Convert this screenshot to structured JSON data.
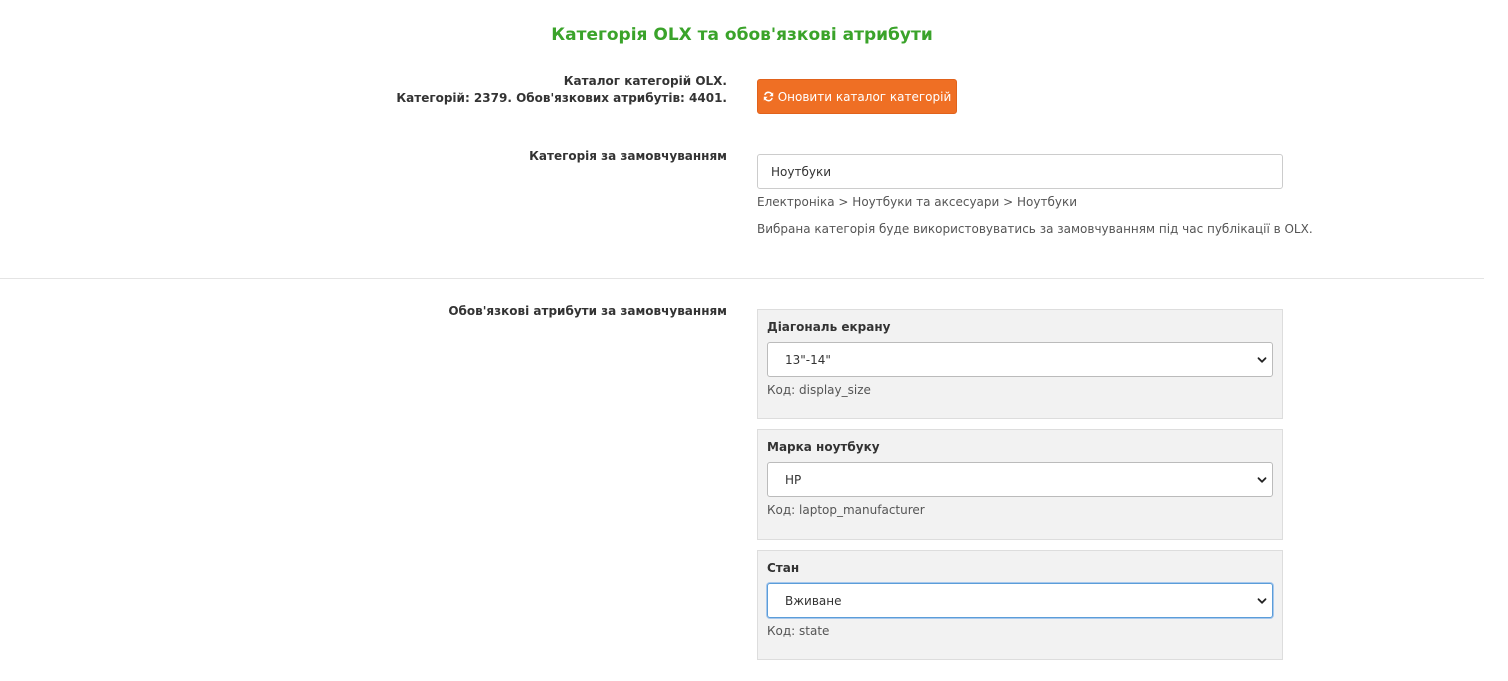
{
  "header": {
    "title": "Категорія OLX та обов'язкові атрибути"
  },
  "catalog": {
    "label_line1": "Каталог категорій OLX.",
    "label_line2": "Категорій: 2379. Обов'язкових атрибутів: 4401.",
    "refresh_button_label": "Оновити каталог категорій",
    "refresh_icon": "refresh-icon"
  },
  "default_category": {
    "label": "Категорія за замовчуванням",
    "input_value": "Ноутбуки",
    "path": "Електроніка > Ноутбуки та аксесуари > Ноутбуки",
    "help": "Вибрана категорія буде використовуватись за замовчуванням під час публікації в OLX."
  },
  "attributes": {
    "label": "Обов'язкові атрибути за замовчуванням",
    "items": [
      {
        "name": "Діагональ екрану",
        "selected": "13\"-14\"",
        "code": "Код: display_size"
      },
      {
        "name": "Марка ноутбуку",
        "selected": "HP",
        "code": "Код: laptop_manufacturer"
      },
      {
        "name": "Стан",
        "selected": "Вживане",
        "code": "Код: state"
      }
    ]
  },
  "colors": {
    "title_green": "#3aa32a",
    "button_orange": "#ef6f24",
    "focus_blue": "#5b9dd9",
    "panel_gray": "#f2f2f2"
  }
}
